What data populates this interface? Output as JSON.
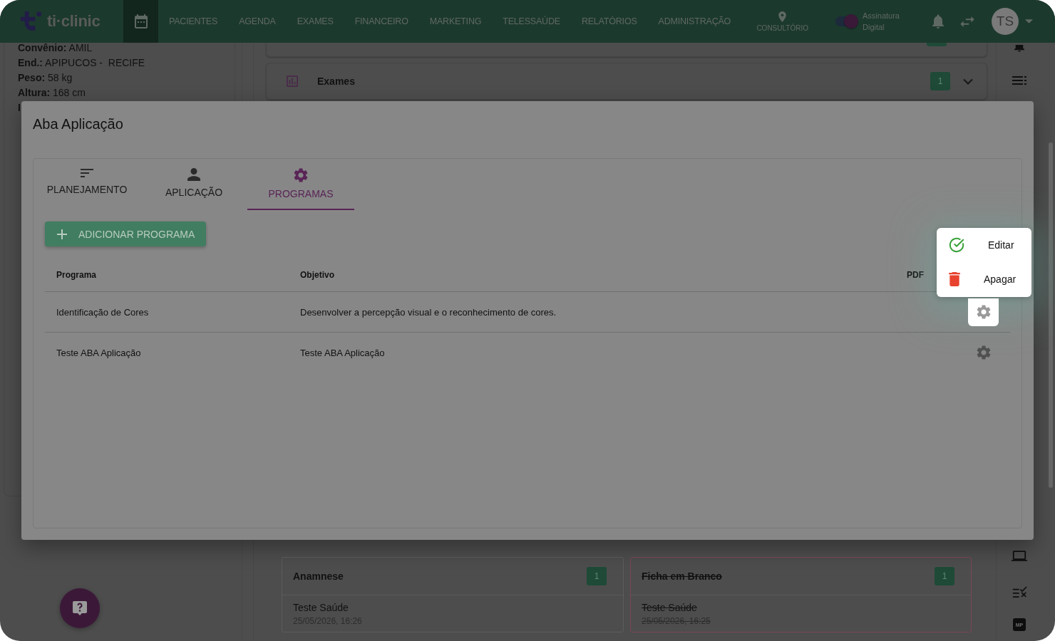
{
  "nav": {
    "logo": "ti·clinic",
    "items": [
      {
        "label": "PACIENTES"
      },
      {
        "label": "AGENDA"
      },
      {
        "label": "EXAMES"
      },
      {
        "label": "FINANCEIRO"
      },
      {
        "label": "MARKETING"
      },
      {
        "label": "TELESSAÚDE"
      },
      {
        "label": "RELATÓRIOS"
      },
      {
        "label": "ADMINISTRAÇÃO"
      }
    ],
    "location": "CONSULTÓRIO",
    "signature": {
      "label": "Assinatura Digital",
      "on": true
    },
    "avatar": "TS"
  },
  "patient": {
    "lines": [
      "**Convênio:** AMIL",
      "**End.:** APIPUCOS -  RECIFE",
      "**Peso:** 58 kg",
      "**Altura:** 168 cm"
    ],
    "cut_line": "I"
  },
  "exams": {
    "title": "Exames",
    "count": "1",
    "expanded": false
  },
  "records": [
    {
      "title": "Anamnese",
      "count": "1",
      "entry": "Teste Saúde",
      "date": "25/05/2026, 16:26",
      "struck": false
    },
    {
      "title": "Ficha em Branco",
      "count": "1",
      "entry": "Teste Saúde",
      "date": "25/05/2026, 16:25",
      "struck": true
    }
  ],
  "side_tile": "MP",
  "dialog": {
    "title": "Aba Aplicação",
    "tabs": [
      {
        "label": "PLANEJAMENTO",
        "selected": false
      },
      {
        "label": "APLICAÇÃO",
        "selected": false
      },
      {
        "label": "PROGRAMAS",
        "selected": true
      }
    ],
    "add_button": "ADICIONAR PROGRAMA",
    "table": {
      "columns": [
        "Programa",
        "Objetivo",
        "PDF"
      ],
      "rows": [
        {
          "cells": [
            "Identificação de Cores",
            "Desenvolver a percepção visual e o reconhecimento de cores."
          ],
          "menu_open": true
        },
        {
          "cells": [
            "Teste ABA Aplicação",
            "Teste ABA Aplicação"
          ],
          "menu_open": false
        }
      ]
    }
  },
  "menu": {
    "items": [
      {
        "kind": "edit",
        "label": "Editar"
      },
      {
        "kind": "delete",
        "label": "Apagar"
      }
    ]
  }
}
